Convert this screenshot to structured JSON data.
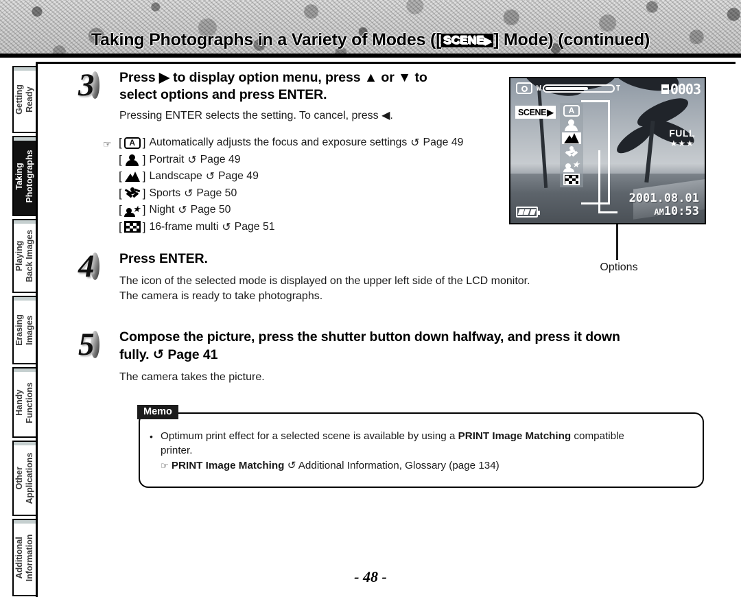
{
  "header": {
    "title_before": "Taking Photographs in a Variety of Modes ([",
    "chip_label": "SCENE",
    "chip_arrow": "▶",
    "title_after": "] Mode) (continued)"
  },
  "sidebar": {
    "tabs": [
      {
        "line1": "Getting",
        "line2": "Ready",
        "active": false
      },
      {
        "line1": "Taking",
        "line2": "Photographs",
        "active": true
      },
      {
        "line1": "Playing",
        "line2": "Back Images",
        "active": false
      },
      {
        "line1": "Erasing",
        "line2": "Images",
        "active": false
      },
      {
        "line1": "Handy",
        "line2": "Functions",
        "active": false
      },
      {
        "line1": "Other",
        "line2": "Applications",
        "active": false
      },
      {
        "line1": "Additional",
        "line2": "Information",
        "active": false
      }
    ]
  },
  "steps": {
    "step3": {
      "number": "3",
      "heading_line1": "Press ▶ to display option menu, press ▲ or ▼ to",
      "heading_line2": "select options and press ENTER.",
      "sub": "Pressing ENTER selects the setting. To cancel, press ◀."
    },
    "step4": {
      "number": "4",
      "heading": "Press ENTER.",
      "sub_line1": "The icon of the selected mode is displayed on the upper left side of the LCD monitor.",
      "sub_line2": "The camera is ready to take photographs."
    },
    "step5": {
      "number": "5",
      "heading_line1": "Compose the picture, press the shutter button down halfway, and press it down",
      "heading_line2_a": "fully. ",
      "heading_line2_cycle": "↺",
      "heading_line2_b": " Page 41",
      "sub": "The camera takes the picture."
    }
  },
  "mode_list": {
    "hand_icon": "☞",
    "bracket_open": "[",
    "bracket_close": "]",
    "cycle_icon": "↺",
    "items": [
      {
        "icon": "auto-mode-icon",
        "icon_text": "A",
        "label": "Automatically adjusts the focus and exposure settings",
        "page": "Page 49"
      },
      {
        "icon": "portrait-mode-icon",
        "icon_text": "",
        "label": "Portrait",
        "page": "Page 49"
      },
      {
        "icon": "landscape-mode-icon",
        "icon_text": "",
        "label": "Landscape",
        "page": "Page 49"
      },
      {
        "icon": "sports-mode-icon",
        "icon_text": "",
        "label": "Sports",
        "page": "Page 50"
      },
      {
        "icon": "night-mode-icon",
        "icon_text": "",
        "label": "Night",
        "page": "Page 50"
      },
      {
        "icon": "multi16-mode-icon",
        "icon_text": "",
        "label": "16-frame multi",
        "page": "Page 51"
      }
    ]
  },
  "lcd": {
    "zoom_w": "W",
    "zoom_t": "T",
    "frame_count": "0003",
    "scene_badge": "SCENE",
    "scene_badge_arrow": "▶",
    "quality_label": "FULL",
    "quality_stars": "★★★",
    "date": "2001.08.01",
    "meridiem": "AM",
    "time": "10:53",
    "menu_icons": [
      "auto-mode-icon",
      "portrait-mode-icon",
      "landscape-mode-icon",
      "sports-mode-icon",
      "night-mode-icon",
      "multi16-mode-icon"
    ],
    "selected_menu_index": 2
  },
  "callout": {
    "label": "Options"
  },
  "memo": {
    "tab_label": "Memo",
    "bullet": "•",
    "line1_a": "Optimum print effect for a selected scene is available by using a ",
    "line1_bold": "PRINT Image Matching",
    "line1_b": " compatible",
    "line2": "printer.",
    "line3_hand": "☞",
    "line3_bold": "PRINT Image Matching",
    "line3_cycle": "↺",
    "line3_rest": " Additional Information, Glossary (page 134)"
  },
  "footer": {
    "page_number": "- 48 -"
  },
  "colors": {
    "ink": "#000000",
    "tab_cap": "#c5cfcf",
    "active_tab_bg": "#111111"
  }
}
